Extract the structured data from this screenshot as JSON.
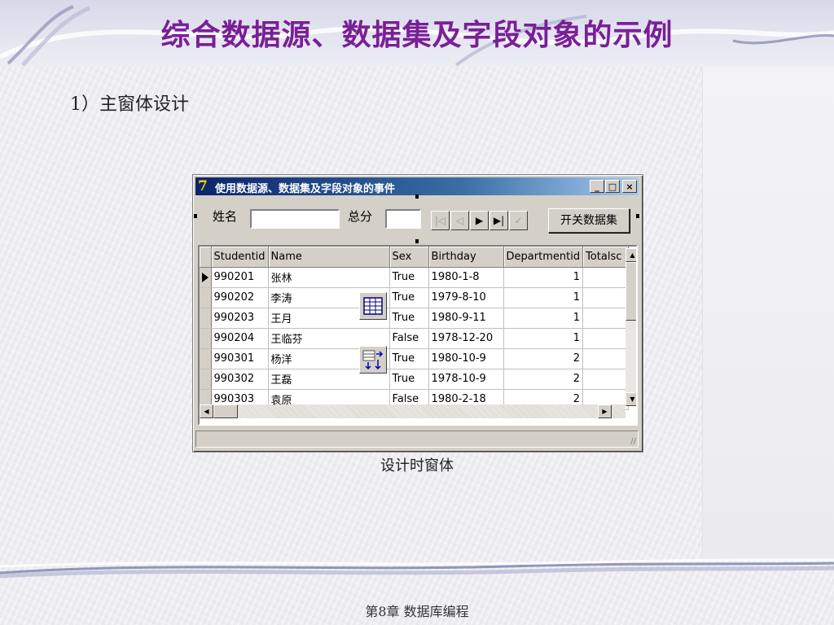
{
  "slide": {
    "title": "综合数据源、数据集及字段对象的示例",
    "section": "1）主窗体设计",
    "caption": "设计时窗体",
    "footer": "第8章 数据库编程"
  },
  "window": {
    "title": "使用数据源、数据集及字段对象的事件",
    "min_label": "_",
    "max_label": "□",
    "close_label": "×"
  },
  "form": {
    "name_label": "姓名",
    "name_value": "",
    "total_label": "总分",
    "total_value": "",
    "toggle_button": "开关数据集",
    "nav": {
      "first": "|◁",
      "prior": "◁",
      "next": "▶",
      "last": "▶|",
      "post": "✓"
    }
  },
  "grid": {
    "columns": [
      "Studentid",
      "Name",
      "Sex",
      "Birthday",
      "Departmentid",
      "Totalsc"
    ],
    "rows": [
      [
        "990201",
        "张林",
        "True",
        "1980-1-8",
        "1",
        ""
      ],
      [
        "990202",
        "李涛",
        "True",
        "1979-8-10",
        "1",
        ""
      ],
      [
        "990203",
        "王月",
        "True",
        "1980-9-11",
        "1",
        ""
      ],
      [
        "990204",
        "王临芬",
        "False",
        "1978-12-20",
        "1",
        ""
      ],
      [
        "990301",
        "杨洋",
        "True",
        "1980-10-9",
        "2",
        ""
      ],
      [
        "990302",
        "王磊",
        "True",
        "1978-10-9",
        "2",
        ""
      ],
      [
        "990303",
        "袁原",
        "False",
        "1980-2-18",
        "2",
        ""
      ]
    ],
    "current_row": 0
  },
  "icons": {
    "app": "delphi-app-icon",
    "datasource_component": "datasource-component-icon",
    "table_component": "table-component-icon"
  },
  "colors": {
    "title": "#7a1f98",
    "titlebar_start": "#0a246a",
    "titlebar_end": "#a6caf0",
    "button_face": "#d4d0c8"
  }
}
